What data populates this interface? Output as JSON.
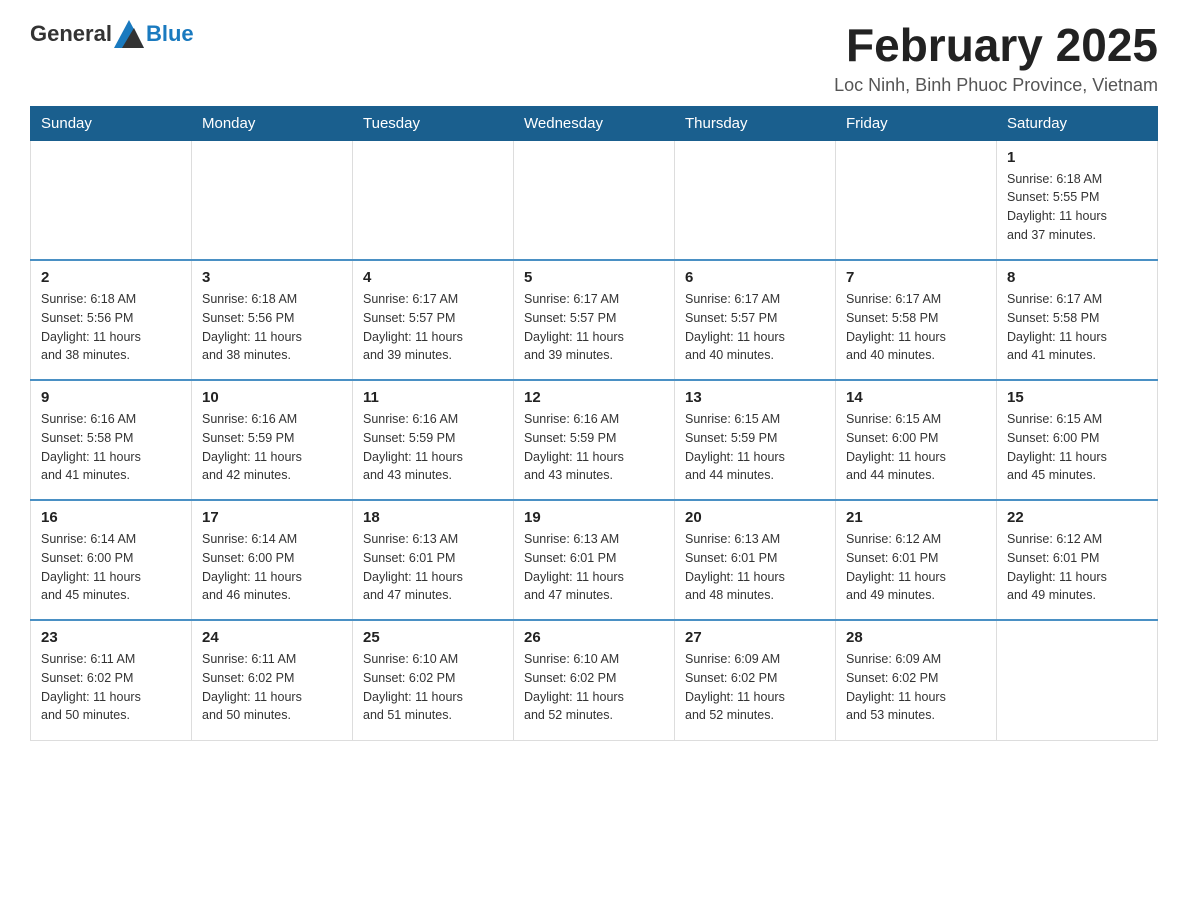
{
  "logo": {
    "general": "General",
    "blue": "Blue"
  },
  "title": "February 2025",
  "subtitle": "Loc Ninh, Binh Phuoc Province, Vietnam",
  "weekdays": [
    "Sunday",
    "Monday",
    "Tuesday",
    "Wednesday",
    "Thursday",
    "Friday",
    "Saturday"
  ],
  "weeks": [
    [
      {
        "day": "",
        "info": ""
      },
      {
        "day": "",
        "info": ""
      },
      {
        "day": "",
        "info": ""
      },
      {
        "day": "",
        "info": ""
      },
      {
        "day": "",
        "info": ""
      },
      {
        "day": "",
        "info": ""
      },
      {
        "day": "1",
        "info": "Sunrise: 6:18 AM\nSunset: 5:55 PM\nDaylight: 11 hours\nand 37 minutes."
      }
    ],
    [
      {
        "day": "2",
        "info": "Sunrise: 6:18 AM\nSunset: 5:56 PM\nDaylight: 11 hours\nand 38 minutes."
      },
      {
        "day": "3",
        "info": "Sunrise: 6:18 AM\nSunset: 5:56 PM\nDaylight: 11 hours\nand 38 minutes."
      },
      {
        "day": "4",
        "info": "Sunrise: 6:17 AM\nSunset: 5:57 PM\nDaylight: 11 hours\nand 39 minutes."
      },
      {
        "day": "5",
        "info": "Sunrise: 6:17 AM\nSunset: 5:57 PM\nDaylight: 11 hours\nand 39 minutes."
      },
      {
        "day": "6",
        "info": "Sunrise: 6:17 AM\nSunset: 5:57 PM\nDaylight: 11 hours\nand 40 minutes."
      },
      {
        "day": "7",
        "info": "Sunrise: 6:17 AM\nSunset: 5:58 PM\nDaylight: 11 hours\nand 40 minutes."
      },
      {
        "day": "8",
        "info": "Sunrise: 6:17 AM\nSunset: 5:58 PM\nDaylight: 11 hours\nand 41 minutes."
      }
    ],
    [
      {
        "day": "9",
        "info": "Sunrise: 6:16 AM\nSunset: 5:58 PM\nDaylight: 11 hours\nand 41 minutes."
      },
      {
        "day": "10",
        "info": "Sunrise: 6:16 AM\nSunset: 5:59 PM\nDaylight: 11 hours\nand 42 minutes."
      },
      {
        "day": "11",
        "info": "Sunrise: 6:16 AM\nSunset: 5:59 PM\nDaylight: 11 hours\nand 43 minutes."
      },
      {
        "day": "12",
        "info": "Sunrise: 6:16 AM\nSunset: 5:59 PM\nDaylight: 11 hours\nand 43 minutes."
      },
      {
        "day": "13",
        "info": "Sunrise: 6:15 AM\nSunset: 5:59 PM\nDaylight: 11 hours\nand 44 minutes."
      },
      {
        "day": "14",
        "info": "Sunrise: 6:15 AM\nSunset: 6:00 PM\nDaylight: 11 hours\nand 44 minutes."
      },
      {
        "day": "15",
        "info": "Sunrise: 6:15 AM\nSunset: 6:00 PM\nDaylight: 11 hours\nand 45 minutes."
      }
    ],
    [
      {
        "day": "16",
        "info": "Sunrise: 6:14 AM\nSunset: 6:00 PM\nDaylight: 11 hours\nand 45 minutes."
      },
      {
        "day": "17",
        "info": "Sunrise: 6:14 AM\nSunset: 6:00 PM\nDaylight: 11 hours\nand 46 minutes."
      },
      {
        "day": "18",
        "info": "Sunrise: 6:13 AM\nSunset: 6:01 PM\nDaylight: 11 hours\nand 47 minutes."
      },
      {
        "day": "19",
        "info": "Sunrise: 6:13 AM\nSunset: 6:01 PM\nDaylight: 11 hours\nand 47 minutes."
      },
      {
        "day": "20",
        "info": "Sunrise: 6:13 AM\nSunset: 6:01 PM\nDaylight: 11 hours\nand 48 minutes."
      },
      {
        "day": "21",
        "info": "Sunrise: 6:12 AM\nSunset: 6:01 PM\nDaylight: 11 hours\nand 49 minutes."
      },
      {
        "day": "22",
        "info": "Sunrise: 6:12 AM\nSunset: 6:01 PM\nDaylight: 11 hours\nand 49 minutes."
      }
    ],
    [
      {
        "day": "23",
        "info": "Sunrise: 6:11 AM\nSunset: 6:02 PM\nDaylight: 11 hours\nand 50 minutes."
      },
      {
        "day": "24",
        "info": "Sunrise: 6:11 AM\nSunset: 6:02 PM\nDaylight: 11 hours\nand 50 minutes."
      },
      {
        "day": "25",
        "info": "Sunrise: 6:10 AM\nSunset: 6:02 PM\nDaylight: 11 hours\nand 51 minutes."
      },
      {
        "day": "26",
        "info": "Sunrise: 6:10 AM\nSunset: 6:02 PM\nDaylight: 11 hours\nand 52 minutes."
      },
      {
        "day": "27",
        "info": "Sunrise: 6:09 AM\nSunset: 6:02 PM\nDaylight: 11 hours\nand 52 minutes."
      },
      {
        "day": "28",
        "info": "Sunrise: 6:09 AM\nSunset: 6:02 PM\nDaylight: 11 hours\nand 53 minutes."
      },
      {
        "day": "",
        "info": ""
      }
    ]
  ]
}
